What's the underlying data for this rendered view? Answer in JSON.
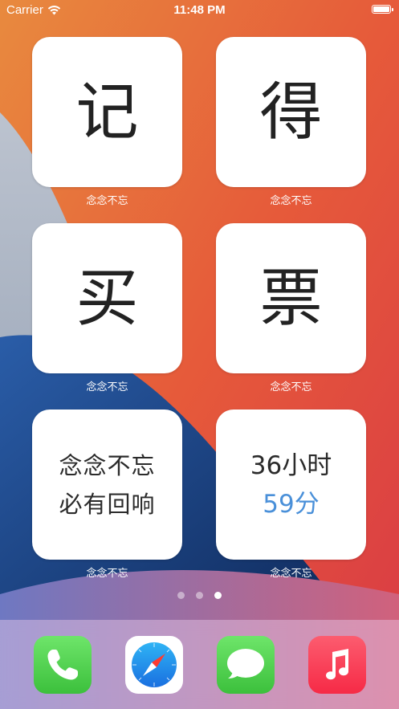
{
  "status_bar": {
    "carrier": "Carrier",
    "time": "11:48 PM"
  },
  "widgets": [
    {
      "text": "记",
      "caption": "念念不忘"
    },
    {
      "text": "得",
      "caption": "念念不忘"
    },
    {
      "text": "买",
      "caption": "念念不忘"
    },
    {
      "text": "票",
      "caption": "念念不忘"
    },
    {
      "line1": "念念不忘",
      "line2": "必有回响",
      "caption": "念念不忘"
    },
    {
      "line1": "36小时",
      "line2": "59分",
      "caption": "念念不忘"
    }
  ],
  "page_indicator": {
    "count": 3,
    "active": 3
  },
  "dock": [
    "phone-icon",
    "safari-icon",
    "messages-icon",
    "music-icon"
  ],
  "colors": {
    "accent_blue": "#4a90d9",
    "phone_green": "#4cd964",
    "music_red": "#fa2d48"
  }
}
